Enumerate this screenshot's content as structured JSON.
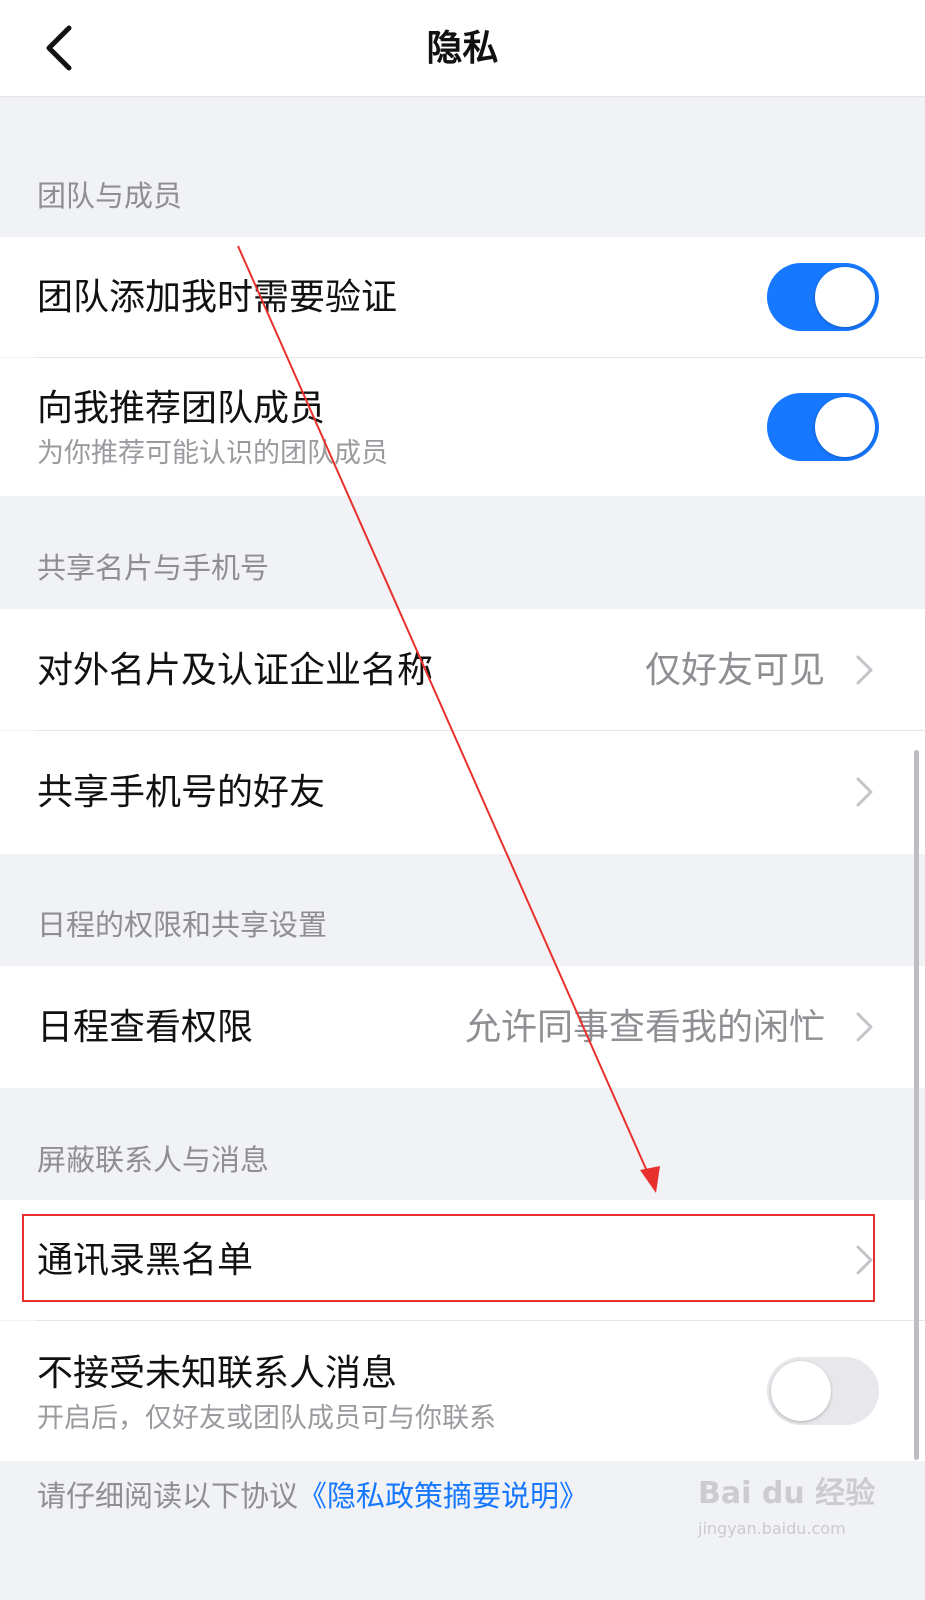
{
  "header": {
    "title": "隐私",
    "back_icon": "chevron-left-icon"
  },
  "sections": [
    {
      "label": "团队与成员",
      "items": [
        {
          "title": "团队添加我时需要验证",
          "control": "toggle",
          "on": true
        },
        {
          "title": "向我推荐团队成员",
          "subtitle": "为你推荐可能认识的团队成员",
          "control": "toggle",
          "on": true
        }
      ]
    },
    {
      "label": "共享名片与手机号",
      "items": [
        {
          "title": "对外名片及认证企业名称",
          "value": "仅好友可见",
          "control": "chevron"
        },
        {
          "title": "共享手机号的好友",
          "control": "chevron"
        }
      ]
    },
    {
      "label": "日程的权限和共享设置",
      "items": [
        {
          "title": "日程查看权限",
          "value": "允许同事查看我的闲忙",
          "control": "chevron"
        }
      ]
    },
    {
      "label": "屏蔽联系人与消息",
      "items": [
        {
          "title": "通讯录黑名单",
          "control": "chevron"
        },
        {
          "title": "不接受未知联系人消息",
          "subtitle": "开启后，仅好友或团队成员可与你联系",
          "control": "toggle",
          "on": false
        }
      ]
    }
  ],
  "footer": {
    "prefix": "请仔细阅读以下协议",
    "link": "《隐私政策摘要说明》"
  },
  "watermark": {
    "main": "Bai du 经验",
    "sub": "jingyan.baidu.com"
  },
  "colors": {
    "accent": "#1677ff",
    "annotation": "#e8312d",
    "background": "#f1f2f6",
    "toggle_off": "#e8e8ec"
  }
}
